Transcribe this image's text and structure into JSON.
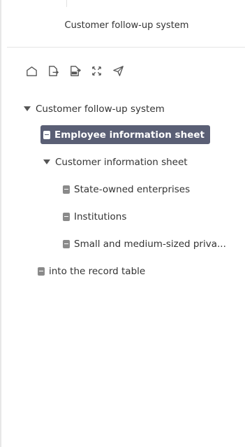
{
  "panel": {
    "title": "Customer follow-up system"
  },
  "toolbar": {
    "icons": [
      "home-icon",
      "export-icon",
      "pdf-export-icon",
      "expand-icon",
      "send-icon"
    ]
  },
  "tree": {
    "root": {
      "label": "Customer follow-up system",
      "expanded": true
    },
    "employee_sheet": {
      "label": "Employee information sheet",
      "selected": true
    },
    "customer_sheet": {
      "label": "Customer information sheet",
      "expanded": true
    },
    "state_owned": {
      "label": "State-owned enterprises"
    },
    "institutions": {
      "label": "Institutions"
    },
    "small_medium": {
      "label": "Small and medium-sized priva..."
    },
    "record_table": {
      "label": "into the record table"
    }
  },
  "colors": {
    "selected_bg": "#5a5f75",
    "text": "#333333",
    "icon": "#8a8a8a"
  }
}
